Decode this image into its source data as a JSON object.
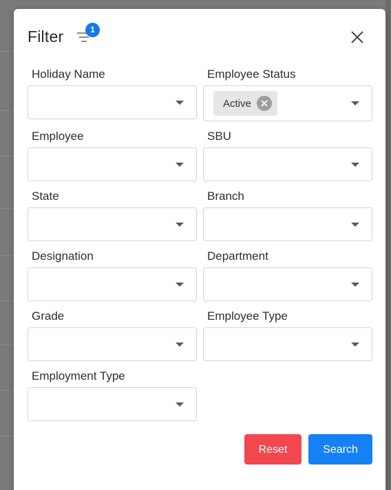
{
  "modal": {
    "title": "Filter",
    "active_filter_count": "1"
  },
  "fields": {
    "holiday_name": {
      "label": "Holiday Name",
      "value": ""
    },
    "employee_status": {
      "label": "Employee Status",
      "selected_chip": "Active"
    },
    "employee": {
      "label": "Employee",
      "value": ""
    },
    "sbu": {
      "label": "SBU",
      "value": ""
    },
    "state": {
      "label": "State",
      "value": ""
    },
    "branch": {
      "label": "Branch",
      "value": ""
    },
    "designation": {
      "label": "Designation",
      "value": ""
    },
    "department": {
      "label": "Department",
      "value": ""
    },
    "grade": {
      "label": "Grade",
      "value": ""
    },
    "employee_type": {
      "label": "Employee Type",
      "value": ""
    },
    "employment_type": {
      "label": "Employment Type",
      "value": ""
    }
  },
  "actions": {
    "reset_label": "Reset",
    "search_label": "Search"
  },
  "colors": {
    "reset": "#f2474e",
    "search": "#1680f5",
    "badge": "#1677e8"
  }
}
